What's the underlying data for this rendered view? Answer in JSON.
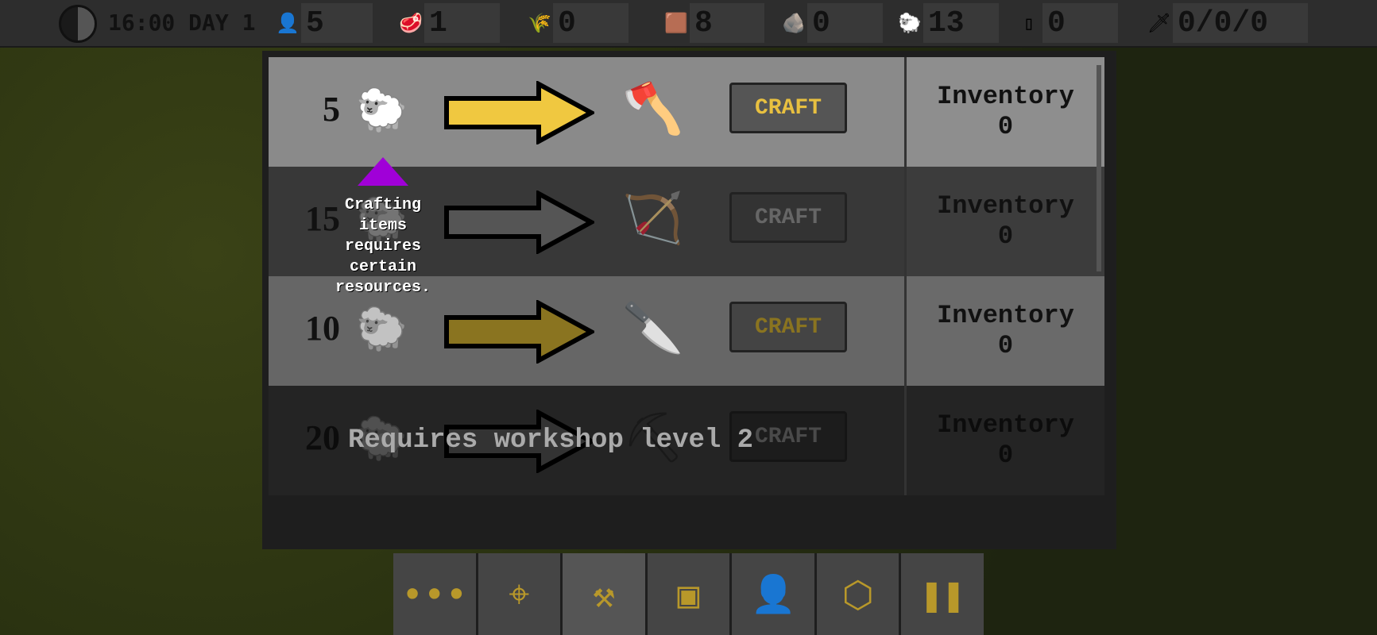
{
  "topbar": {
    "time": "16:00 DAY 1",
    "population": "5",
    "meat": "1",
    "grain": "0",
    "wood": "8",
    "stone": "0",
    "fur": "13",
    "iron": "0",
    "weapons": "0/0/0"
  },
  "colors": {
    "accent_gold": "#e8c040",
    "tooltip_arrow": "#a000d8"
  },
  "recipes": [
    {
      "cost": "5",
      "material": "fur",
      "item": "axe",
      "craft": "CRAFT",
      "inv_label": "Inventory",
      "inv_count": "0",
      "state": "available"
    },
    {
      "cost": "15",
      "material": "fur",
      "item": "bow",
      "craft": "CRAFT",
      "inv_label": "Inventory",
      "inv_count": "0",
      "state": "unavailable"
    },
    {
      "cost": "10",
      "material": "fur",
      "item": "knife",
      "craft": "CRAFT",
      "inv_label": "Inventory",
      "inv_count": "0",
      "state": "available"
    },
    {
      "cost": "20",
      "material": "fur",
      "item": "pickaxe",
      "craft": "CRAFT",
      "inv_label": "Inventory",
      "inv_count": "0",
      "state": "locked"
    }
  ],
  "locked_message": "Requires workshop level 2",
  "tooltip": "Crafting items requires certain resources.",
  "bottombar": [
    "more-icon",
    "target-icon",
    "anvil-icon",
    "crate-icon",
    "person-icon",
    "network-icon",
    "pause-icon"
  ]
}
